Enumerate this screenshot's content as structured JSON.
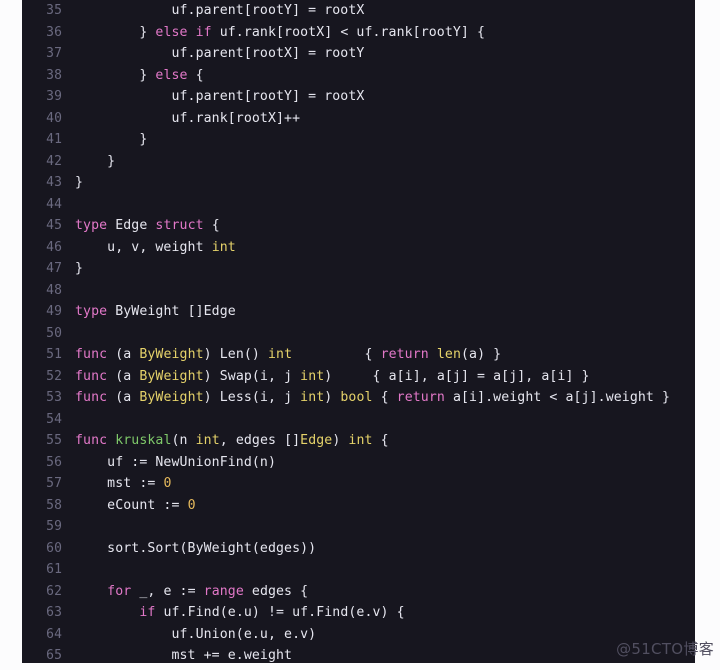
{
  "editor": {
    "language": "go",
    "theme": "dark",
    "background_color": "#17161f",
    "line_number_color": "#6a697f",
    "first_visible_line": 35,
    "last_visible_line": 65,
    "tokens": {
      "keyword_color": "#e278c8",
      "type_color": "#e5d26a",
      "function_color": "#7fc96a",
      "number_color": "#e5b95c",
      "plain_color": "#e6e6ef"
    },
    "lines": [
      {
        "n": "35",
        "parts": [
          {
            "t": "            uf.parent[rootY] = rootX",
            "c": "pl"
          }
        ]
      },
      {
        "n": "36",
        "parts": [
          {
            "t": "        } ",
            "c": "pl"
          },
          {
            "t": "else if",
            "c": "kw"
          },
          {
            "t": " uf.rank[rootX] < uf.rank[rootY] {",
            "c": "pl"
          }
        ]
      },
      {
        "n": "37",
        "parts": [
          {
            "t": "            uf.parent[rootX] = rootY",
            "c": "pl"
          }
        ]
      },
      {
        "n": "38",
        "parts": [
          {
            "t": "        } ",
            "c": "pl"
          },
          {
            "t": "else",
            "c": "kw"
          },
          {
            "t": " {",
            "c": "pl"
          }
        ]
      },
      {
        "n": "39",
        "parts": [
          {
            "t": "            uf.parent[rootY] = rootX",
            "c": "pl"
          }
        ]
      },
      {
        "n": "40",
        "parts": [
          {
            "t": "            uf.rank[rootX]++",
            "c": "pl"
          }
        ]
      },
      {
        "n": "41",
        "parts": [
          {
            "t": "        }",
            "c": "pl"
          }
        ]
      },
      {
        "n": "42",
        "parts": [
          {
            "t": "    }",
            "c": "pl"
          }
        ]
      },
      {
        "n": "43",
        "parts": [
          {
            "t": "}",
            "c": "pl"
          }
        ]
      },
      {
        "n": "44",
        "parts": [
          {
            "t": "",
            "c": "pl"
          }
        ]
      },
      {
        "n": "45",
        "parts": [
          {
            "t": "type",
            "c": "kw"
          },
          {
            "t": " Edge ",
            "c": "pl"
          },
          {
            "t": "struct",
            "c": "kw"
          },
          {
            "t": " {",
            "c": "pl"
          }
        ]
      },
      {
        "n": "46",
        "parts": [
          {
            "t": "    u, v, weight ",
            "c": "pl"
          },
          {
            "t": "int",
            "c": "typ"
          }
        ]
      },
      {
        "n": "47",
        "parts": [
          {
            "t": "}",
            "c": "pl"
          }
        ]
      },
      {
        "n": "48",
        "parts": [
          {
            "t": "",
            "c": "pl"
          }
        ]
      },
      {
        "n": "49",
        "parts": [
          {
            "t": "type",
            "c": "kw"
          },
          {
            "t": " ByWeight []Edge",
            "c": "pl"
          }
        ]
      },
      {
        "n": "50",
        "parts": [
          {
            "t": "",
            "c": "pl"
          }
        ]
      },
      {
        "n": "51",
        "parts": [
          {
            "t": "func",
            "c": "kw"
          },
          {
            "t": " (a ",
            "c": "pl"
          },
          {
            "t": "ByWeight",
            "c": "typ"
          },
          {
            "t": ") Len() ",
            "c": "pl"
          },
          {
            "t": "int",
            "c": "typ"
          },
          {
            "t": "         { ",
            "c": "pl"
          },
          {
            "t": "return",
            "c": "kw"
          },
          {
            "t": " ",
            "c": "pl"
          },
          {
            "t": "len",
            "c": "typ"
          },
          {
            "t": "(a) }",
            "c": "pl"
          }
        ]
      },
      {
        "n": "52",
        "parts": [
          {
            "t": "func",
            "c": "kw"
          },
          {
            "t": " (a ",
            "c": "pl"
          },
          {
            "t": "ByWeight",
            "c": "typ"
          },
          {
            "t": ") Swap(i, j ",
            "c": "pl"
          },
          {
            "t": "int",
            "c": "typ"
          },
          {
            "t": ")     { a[i], a[j] = a[j], a[i] }",
            "c": "pl"
          }
        ]
      },
      {
        "n": "53",
        "parts": [
          {
            "t": "func",
            "c": "kw"
          },
          {
            "t": " (a ",
            "c": "pl"
          },
          {
            "t": "ByWeight",
            "c": "typ"
          },
          {
            "t": ") Less(i, j ",
            "c": "pl"
          },
          {
            "t": "int",
            "c": "typ"
          },
          {
            "t": ") ",
            "c": "pl"
          },
          {
            "t": "bool",
            "c": "typ"
          },
          {
            "t": " { ",
            "c": "pl"
          },
          {
            "t": "return",
            "c": "kw"
          },
          {
            "t": " a[i].weight < a[j].weight }",
            "c": "pl"
          }
        ]
      },
      {
        "n": "54",
        "parts": [
          {
            "t": "",
            "c": "pl"
          }
        ]
      },
      {
        "n": "55",
        "parts": [
          {
            "t": "func",
            "c": "kw"
          },
          {
            "t": " ",
            "c": "pl"
          },
          {
            "t": "kruskal",
            "c": "fn"
          },
          {
            "t": "(n ",
            "c": "pl"
          },
          {
            "t": "int",
            "c": "typ"
          },
          {
            "t": ", edges []",
            "c": "pl"
          },
          {
            "t": "Edge",
            "c": "typ"
          },
          {
            "t": ") ",
            "c": "pl"
          },
          {
            "t": "int",
            "c": "typ"
          },
          {
            "t": " {",
            "c": "pl"
          }
        ]
      },
      {
        "n": "56",
        "parts": [
          {
            "t": "    uf := NewUnionFind(n)",
            "c": "pl"
          }
        ]
      },
      {
        "n": "57",
        "parts": [
          {
            "t": "    mst := ",
            "c": "pl"
          },
          {
            "t": "0",
            "c": "num"
          }
        ]
      },
      {
        "n": "58",
        "parts": [
          {
            "t": "    eCount := ",
            "c": "pl"
          },
          {
            "t": "0",
            "c": "num"
          }
        ]
      },
      {
        "n": "59",
        "parts": [
          {
            "t": "",
            "c": "pl"
          }
        ]
      },
      {
        "n": "60",
        "parts": [
          {
            "t": "    sort.Sort(ByWeight(edges))",
            "c": "pl"
          }
        ]
      },
      {
        "n": "61",
        "parts": [
          {
            "t": "",
            "c": "pl"
          }
        ]
      },
      {
        "n": "62",
        "parts": [
          {
            "t": "    ",
            "c": "pl"
          },
          {
            "t": "for",
            "c": "kw"
          },
          {
            "t": " _, e := ",
            "c": "pl"
          },
          {
            "t": "range",
            "c": "kw"
          },
          {
            "t": " edges {",
            "c": "pl"
          }
        ]
      },
      {
        "n": "63",
        "parts": [
          {
            "t": "        ",
            "c": "pl"
          },
          {
            "t": "if",
            "c": "kw"
          },
          {
            "t": " uf.Find(e.u) != uf.Find(e.v) {",
            "c": "pl"
          }
        ]
      },
      {
        "n": "64",
        "parts": [
          {
            "t": "            uf.Union(e.u, e.v)",
            "c": "pl"
          }
        ]
      },
      {
        "n": "65",
        "parts": [
          {
            "t": "            mst += e.weight",
            "c": "pl"
          }
        ]
      }
    ]
  },
  "scrollbar": {
    "orientation": "horizontal",
    "thumb_width_percent": 84
  },
  "watermark": {
    "text": "@51CTO博客"
  }
}
